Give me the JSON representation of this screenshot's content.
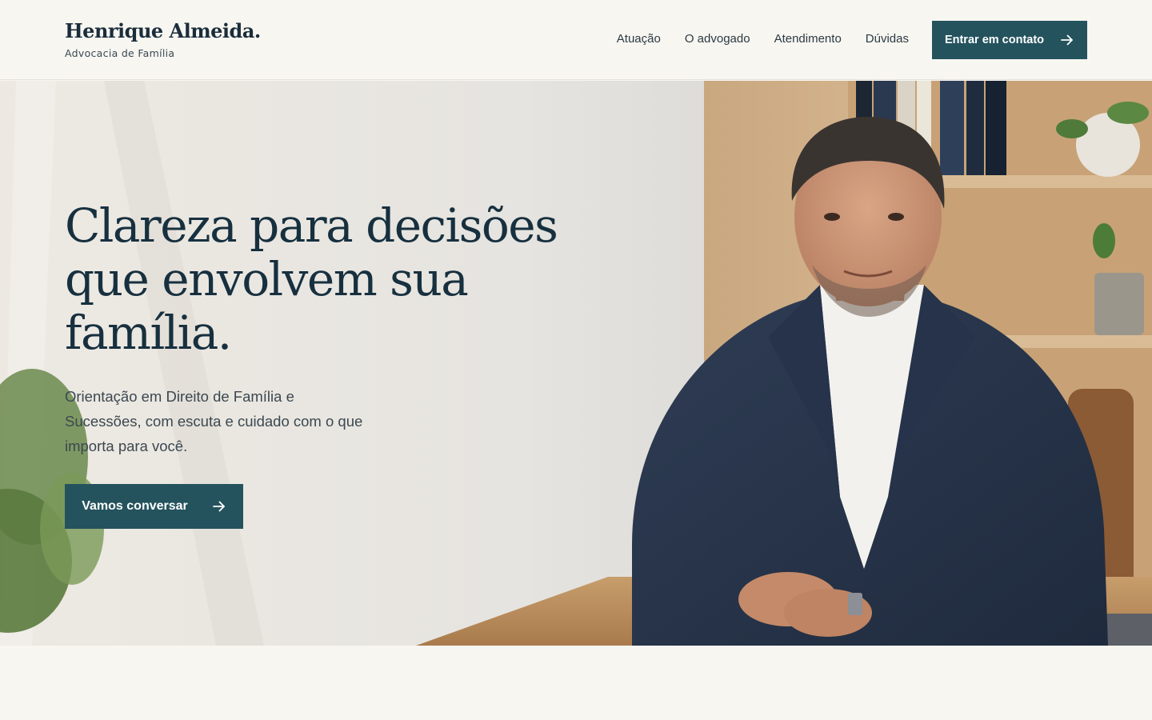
{
  "header": {
    "brand_name": "Henrique Almeida.",
    "brand_tagline": "Advocacia de Família",
    "nav": [
      {
        "label": "Atuação"
      },
      {
        "label": "O advogado"
      },
      {
        "label": "Atendimento"
      },
      {
        "label": "Dúvidas"
      }
    ],
    "cta_label": "Entrar em contato",
    "cta_icon": "arrow-right-icon"
  },
  "hero": {
    "title_lines": [
      "Clareza para decisões",
      "que envolvem sua",
      "família."
    ],
    "subtitle_lines": [
      "Orientação em Direito de Família e",
      "Sucessões, com escuta e cuidado com o que",
      "importa para você."
    ],
    "cta_label": "Vamos conversar",
    "cta_icon": "arrow-right-icon",
    "photo": "lawyer-portrait"
  },
  "colors": {
    "background": "#f7f6f1",
    "accent": "#24535e",
    "heading": "#17303f",
    "text": "#3b4850"
  }
}
